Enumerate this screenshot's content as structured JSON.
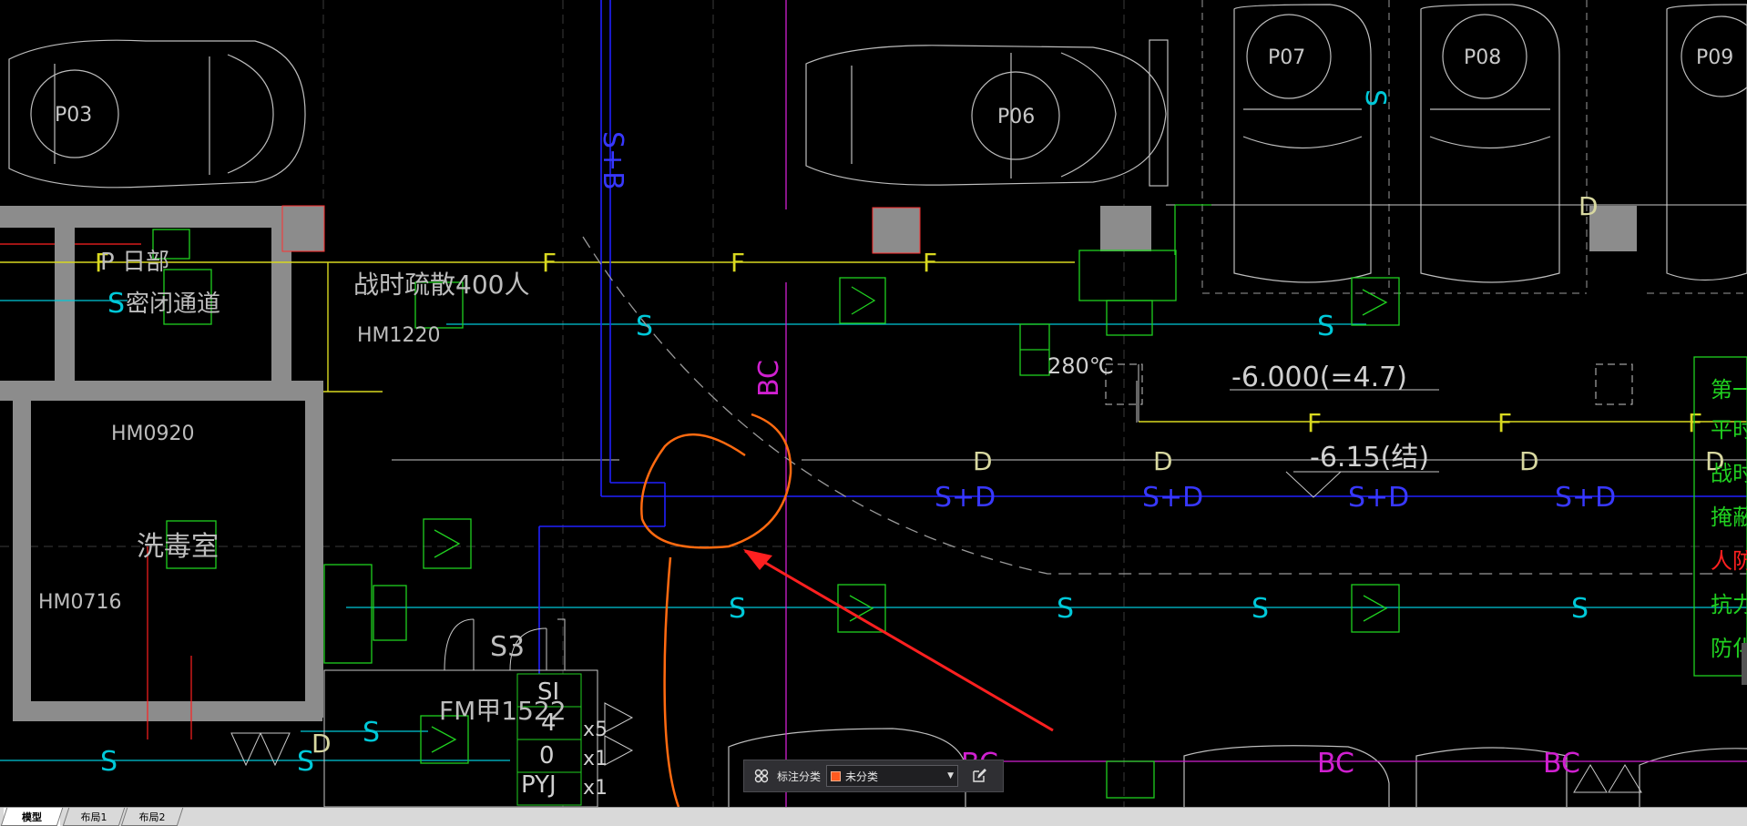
{
  "drawing": {
    "parking": [
      {
        "label": "P03"
      },
      {
        "label": "P06"
      },
      {
        "label": "P07"
      },
      {
        "label": "P08"
      },
      {
        "label": "P09"
      }
    ],
    "rooms": {
      "passage": "P 日部\n密闭通道",
      "decontam": "洗毒室",
      "evac": "战时疏散400人"
    },
    "doors": {
      "hm1220": "HM1220",
      "hm0920": "HM0920",
      "hm0716": "HM0716",
      "fm1522": "FM甲1522",
      "s3": "S3"
    },
    "markers": {
      "F": "F",
      "S": "S",
      "D": "D",
      "SD": "S+D",
      "BC": "BC",
      "SBD": "S+B"
    },
    "temp": "280℃",
    "elev1": "-6.000(=4.7)",
    "elev2": "-6.15(结)",
    "stack": [
      "SI",
      "4",
      "0",
      "PYJ",
      "x5",
      "x1",
      "x1"
    ],
    "legend": [
      "第一",
      "平时",
      "战时",
      "掩蔽",
      "人防",
      "抗力",
      "防化"
    ],
    "colors": {
      "cyan": "#00c8d8",
      "yellow": "#d8d820",
      "blue": "#2020ff",
      "magenta": "#d020d0",
      "green": "#20d020",
      "red": "#ff2020",
      "orange": "#ff6a10",
      "white": "#d0d0d0",
      "gray": "#8c8c8c"
    }
  },
  "toolbar": {
    "label": "标注分类",
    "selected": "未分类",
    "grid_icon": "grid-icon",
    "edit_icon": "edit-icon"
  },
  "tabs": {
    "model": "模型",
    "layout1": "布局1",
    "layout2": "布局2"
  }
}
